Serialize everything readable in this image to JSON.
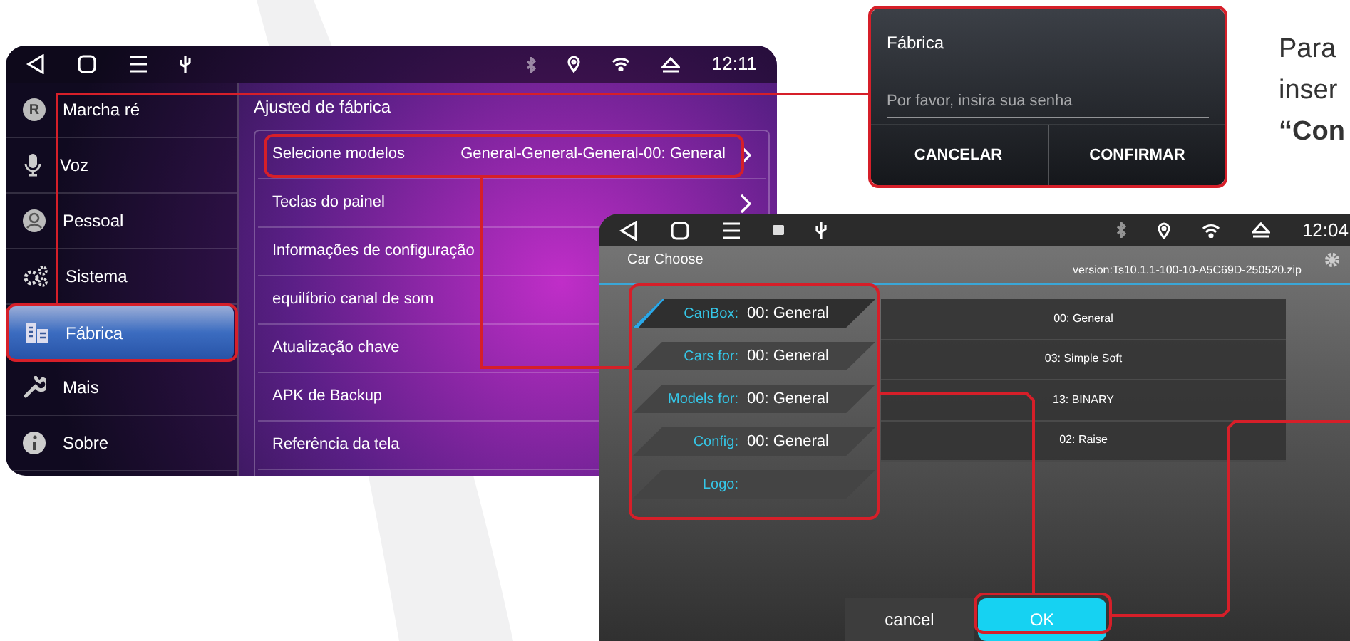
{
  "main_screen": {
    "status_bar": {
      "time": "12:11"
    },
    "sidebar": {
      "items": [
        {
          "label": "Marcha ré",
          "icon_text": "R",
          "selected": false
        },
        {
          "label": "Voz",
          "selected": false
        },
        {
          "label": "Pessoal",
          "selected": false
        },
        {
          "label": "Sistema",
          "selected": false
        },
        {
          "label": "Fábrica",
          "selected": true
        },
        {
          "label": "Mais",
          "selected": false
        },
        {
          "label": "Sobre",
          "selected": false
        }
      ]
    },
    "section_title": "Ajusted de fábrica",
    "settings": [
      {
        "label": "Selecione modelos",
        "value": "General-General-General-00: General",
        "kind": "nav"
      },
      {
        "label": "Teclas do painel",
        "kind": "nav"
      },
      {
        "label": "Informações de configuração",
        "kind": "plain"
      },
      {
        "label": "equilíbrio canal de som",
        "kind": "plain"
      },
      {
        "label": "Atualização chave",
        "kind": "plain"
      },
      {
        "label": "APK de Backup",
        "kind": "plain"
      },
      {
        "label": "Referência da tela",
        "kind": "plain"
      }
    ]
  },
  "password_dialog": {
    "title": "Fábrica",
    "placeholder": "Por favor, insira sua senha",
    "buttons": [
      "CANCELAR",
      "CONFIRMAR"
    ]
  },
  "instructions": [
    {
      "text": "Para",
      "bold": false
    },
    {
      "text": "inser",
      "bold": false
    },
    {
      "text": "“Con",
      "bold": true
    }
  ],
  "car_choose_screen": {
    "status_bar": {
      "time": "12:04"
    },
    "title": "Car Choose",
    "version": "version:Ts10.1.1-100-10-A5C69D-250520.zip",
    "fields": [
      {
        "label": "CanBox:",
        "value": "00: General",
        "selected": true
      },
      {
        "label": "Cars for:",
        "value": "00: General",
        "selected": false
      },
      {
        "label": "Models for:",
        "value": "00: General",
        "selected": false
      },
      {
        "label": "Config:",
        "value": "00: General",
        "selected": false
      },
      {
        "label": "Logo:",
        "selected": false
      }
    ],
    "options": [
      "00: General",
      "03: Simple Soft",
      "13: BINARY",
      "02: Raise"
    ],
    "buttons": [
      {
        "label": "cancel",
        "selected": false
      },
      {
        "label": "OK",
        "selected": true
      }
    ]
  }
}
